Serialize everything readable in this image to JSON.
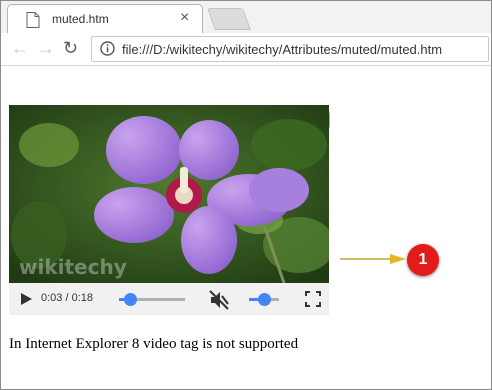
{
  "browser": {
    "tab_title": "muted.htm",
    "close_glyph": "×",
    "url": "file:///D:/wikitechy/wikitechy/Attributes/muted/muted.htm",
    "nav": {
      "back": "←",
      "forward": "→",
      "reload": "↻"
    }
  },
  "video": {
    "watermark": "wikitechy",
    "current_time": "0:03",
    "duration": "0:18",
    "time_display": "0:03 / 0:18",
    "progress_fraction": 0.17,
    "volume_fraction": 0.5,
    "muted": true,
    "icons": [
      "play-icon",
      "muted-speaker-icon",
      "fullscreen-icon"
    ]
  },
  "annotation": {
    "badge_label": "1",
    "arrow_color": "#e6b422",
    "badge_color": "#e21b1b"
  },
  "caption": "In Internet Explorer 8 video tag is not supported"
}
